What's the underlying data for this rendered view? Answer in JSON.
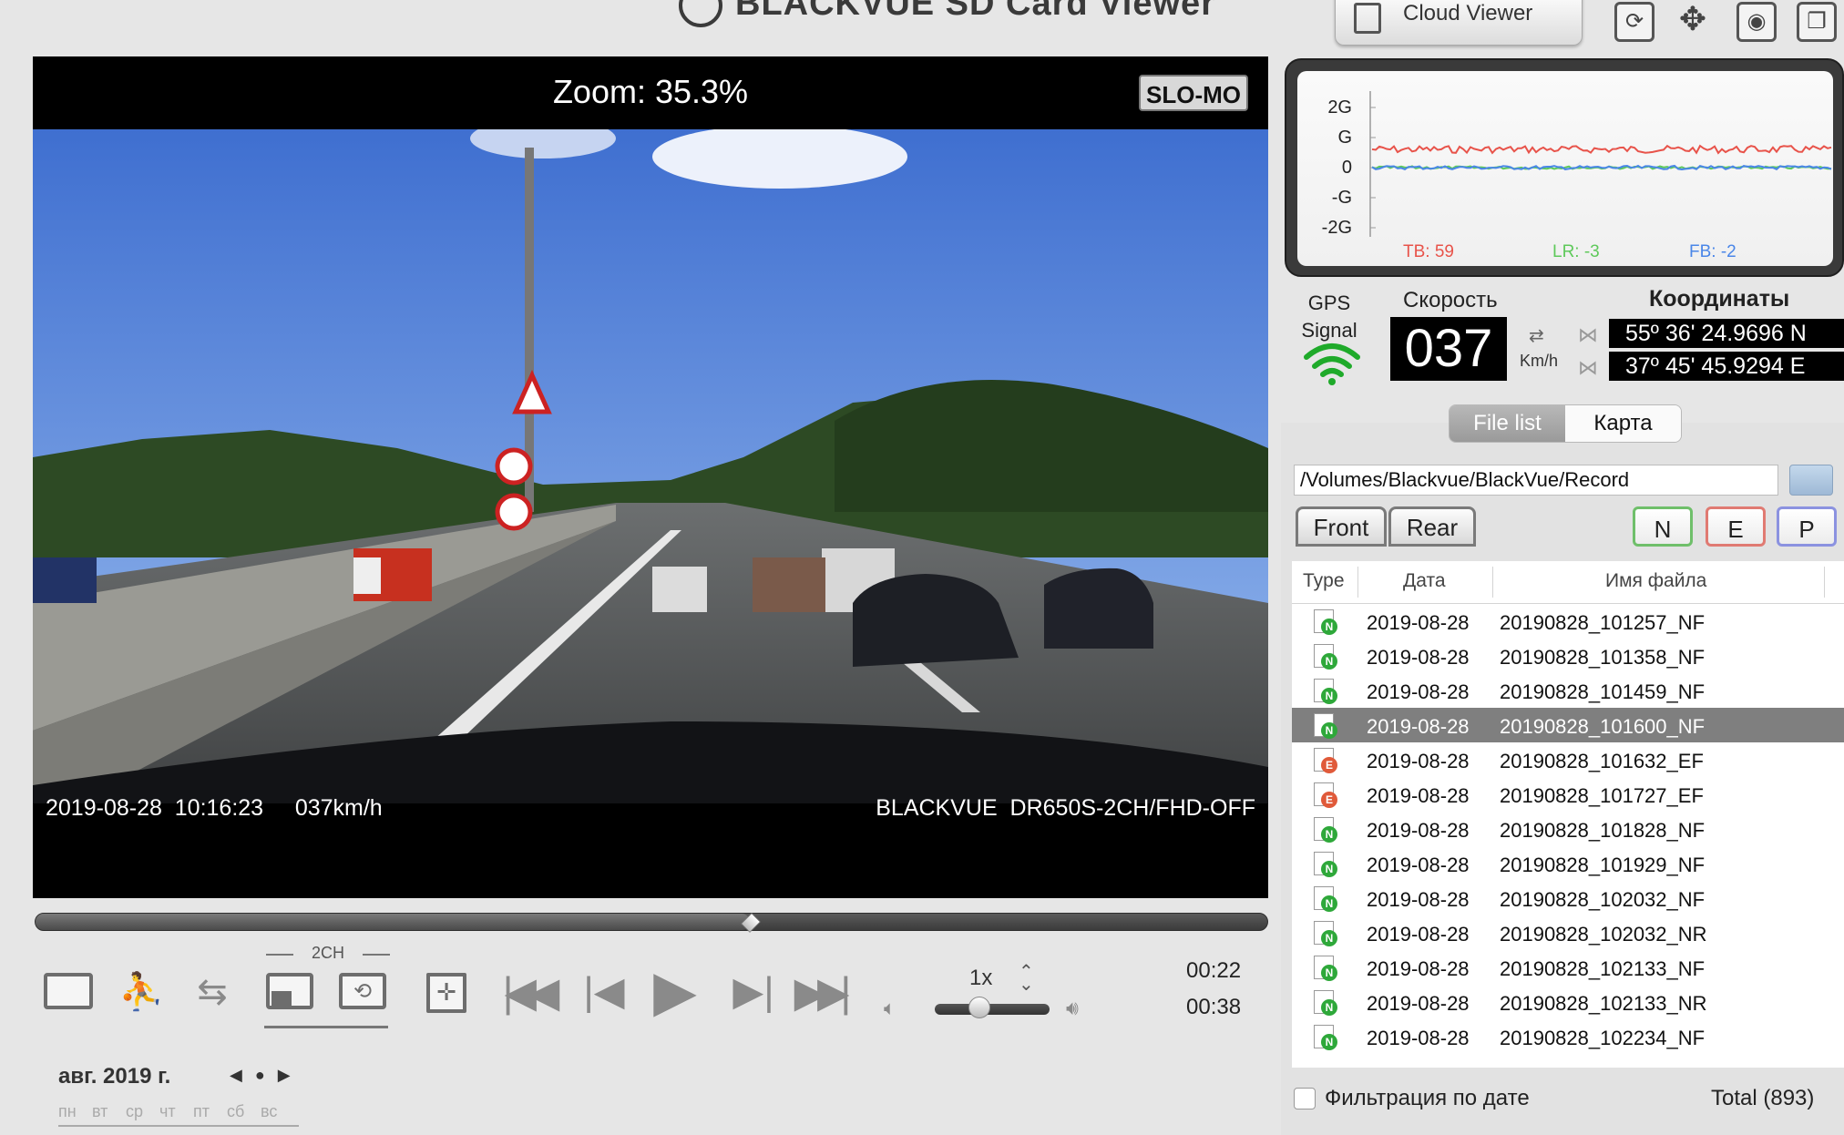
{
  "app": {
    "title": "BLACKVUE SD Card Viewer",
    "cloud_viewer_label": "Cloud Viewer"
  },
  "toolbar_icons": [
    "refresh-icon",
    "compass-icon",
    "camera-icon",
    "window-icon"
  ],
  "video": {
    "zoom_label": "Zoom: 35.3%",
    "slomo_label": "SLO-MO",
    "osd_left": "2019-08-28  10:16:23     037km/h",
    "osd_right": "BLACKVUE  DR650S-2CH/FHD-OFF",
    "progress": 0.58
  },
  "controls": {
    "ch_label": "2CH",
    "speed_label": "1x",
    "volume": 0.38,
    "time_current": "00:22",
    "time_total": "00:38"
  },
  "calendar": {
    "month": "авг. 2019 г.",
    "days": [
      "пн",
      "вт",
      "ср",
      "чт",
      "пт",
      "сб",
      "вс"
    ]
  },
  "gsensor": {
    "y_ticks": [
      "2G",
      "G",
      "0",
      "-G",
      "-2G"
    ],
    "tb_label": "TB: 59",
    "lr_label": "LR: -3",
    "fb_label": "FB: -2",
    "colors": {
      "tb": "#e8534a",
      "lr": "#5ec95a",
      "fb": "#4a86e8"
    }
  },
  "gps": {
    "signal_label_1": "GPS",
    "signal_label_2": "Signal",
    "speed_title": "Скорость",
    "speed_value": "037",
    "speed_unit": "Km/h",
    "coord_title": "Координаты",
    "lat": "55º 36' 24.9696 N",
    "lon": "37º 45' 45.9294 E"
  },
  "tabs": {
    "files": "File list",
    "map": "Карта"
  },
  "path": "/Volumes/Blackvue/BlackVue/Record",
  "camera_buttons": {
    "front": "Front",
    "rear": "Rear"
  },
  "type_filters": {
    "n": "N",
    "e": "E",
    "p": "P",
    "colors": {
      "n": "#6fbf6a",
      "e": "#e07a72",
      "p": "#8b92e0"
    }
  },
  "table": {
    "headers": {
      "type": "Type",
      "date": "Дата",
      "name": "Имя файла"
    },
    "rows": [
      {
        "type": "N",
        "date": "2019-08-28",
        "name": "20190828_101257_NF"
      },
      {
        "type": "N",
        "date": "2019-08-28",
        "name": "20190828_101358_NF"
      },
      {
        "type": "N",
        "date": "2019-08-28",
        "name": "20190828_101459_NF"
      },
      {
        "type": "N",
        "date": "2019-08-28",
        "name": "20190828_101600_NF",
        "selected": true
      },
      {
        "type": "E",
        "date": "2019-08-28",
        "name": "20190828_101632_EF"
      },
      {
        "type": "E",
        "date": "2019-08-28",
        "name": "20190828_101727_EF"
      },
      {
        "type": "N",
        "date": "2019-08-28",
        "name": "20190828_101828_NF"
      },
      {
        "type": "N",
        "date": "2019-08-28",
        "name": "20190828_101929_NF"
      },
      {
        "type": "N",
        "date": "2019-08-28",
        "name": "20190828_102032_NF"
      },
      {
        "type": "N",
        "date": "2019-08-28",
        "name": "20190828_102032_NR"
      },
      {
        "type": "N",
        "date": "2019-08-28",
        "name": "20190828_102133_NF"
      },
      {
        "type": "N",
        "date": "2019-08-28",
        "name": "20190828_102133_NR"
      },
      {
        "type": "N",
        "date": "2019-08-28",
        "name": "20190828_102234_NF"
      }
    ]
  },
  "footer": {
    "filter_label": "Фильтрация по дате",
    "total_label": "Total (893)"
  }
}
